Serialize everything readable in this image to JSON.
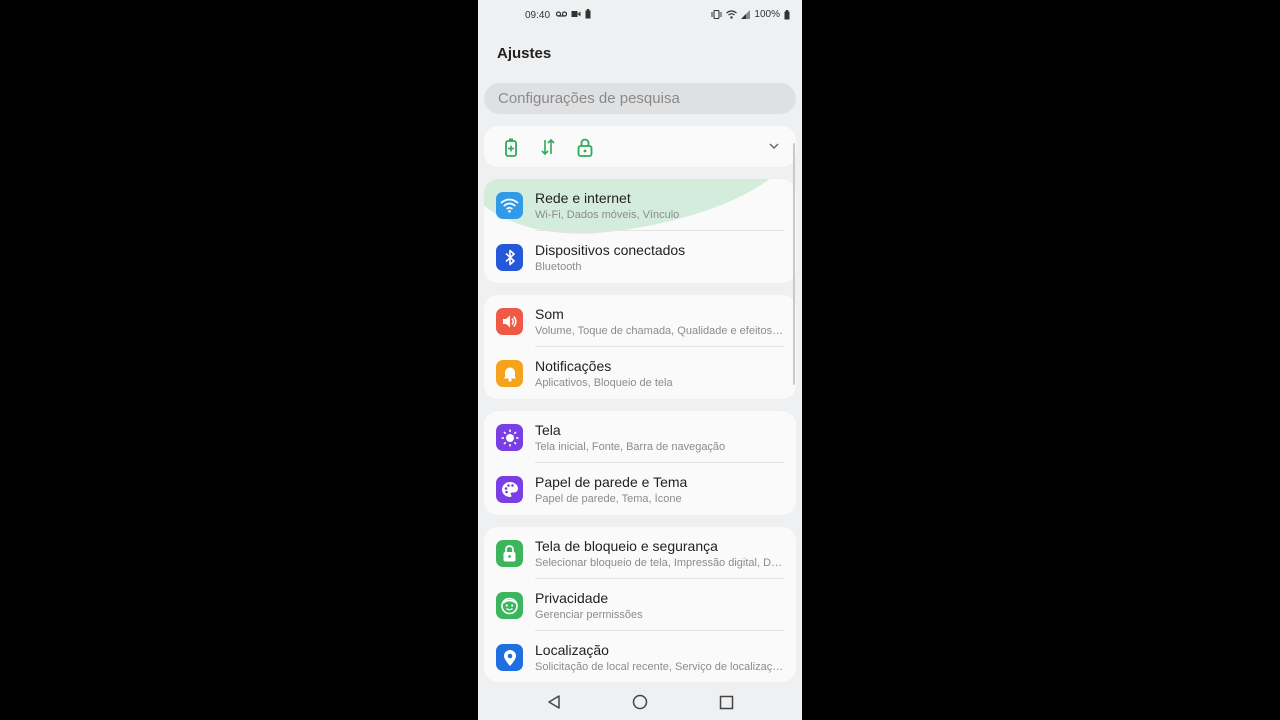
{
  "status": {
    "time": "09:40",
    "battery_pct": "100%"
  },
  "page_title": "Ajustes",
  "search": {
    "placeholder": "Configurações de pesquisa"
  },
  "quick_settings": {
    "icons": [
      "battery-saver-icon",
      "data-transfer-icon",
      "lock-icon"
    ],
    "accent": "#2eaa5c"
  },
  "groups": [
    {
      "items": [
        {
          "title": "Rede e internet",
          "subtitle": "Wi-Fi, Dados móveis, Vínculo",
          "icon": "wifi-icon",
          "color": "#2f9be8"
        },
        {
          "title": "Dispositivos conectados",
          "subtitle": "Bluetooth",
          "icon": "bluetooth-icon",
          "color": "#2458d8"
        }
      ]
    },
    {
      "items": [
        {
          "title": "Som",
          "subtitle": "Volume, Toque de chamada, Qualidade e efeitos…",
          "icon": "speaker-icon",
          "color": "#ee5a45"
        },
        {
          "title": "Notificações",
          "subtitle": "Aplicativos, Bloqueio de tela",
          "icon": "bell-icon",
          "color": "#f5a21c"
        }
      ]
    },
    {
      "items": [
        {
          "title": "Tela",
          "subtitle": "Tela inicial, Fonte, Barra de navegação",
          "icon": "brightness-icon",
          "color": "#7a3fe4"
        },
        {
          "title": "Papel de parede e Tema",
          "subtitle": "Papel de parede, Tema, Ícone",
          "icon": "palette-icon",
          "color": "#7a3fe4"
        }
      ]
    },
    {
      "items": [
        {
          "title": "Tela de bloqueio e segurança",
          "subtitle": "Selecionar bloqueio de tela, Impressão digital, D…",
          "icon": "lock-icon",
          "color": "#3cb65d"
        },
        {
          "title": "Privacidade",
          "subtitle": "Gerenciar permissões",
          "icon": "privacy-icon",
          "color": "#3cb65d"
        },
        {
          "title": "Localização",
          "subtitle": "Solicitação de local recente, Serviço de localizaç…",
          "icon": "location-pin-icon",
          "color": "#1f6fe0"
        }
      ]
    }
  ]
}
